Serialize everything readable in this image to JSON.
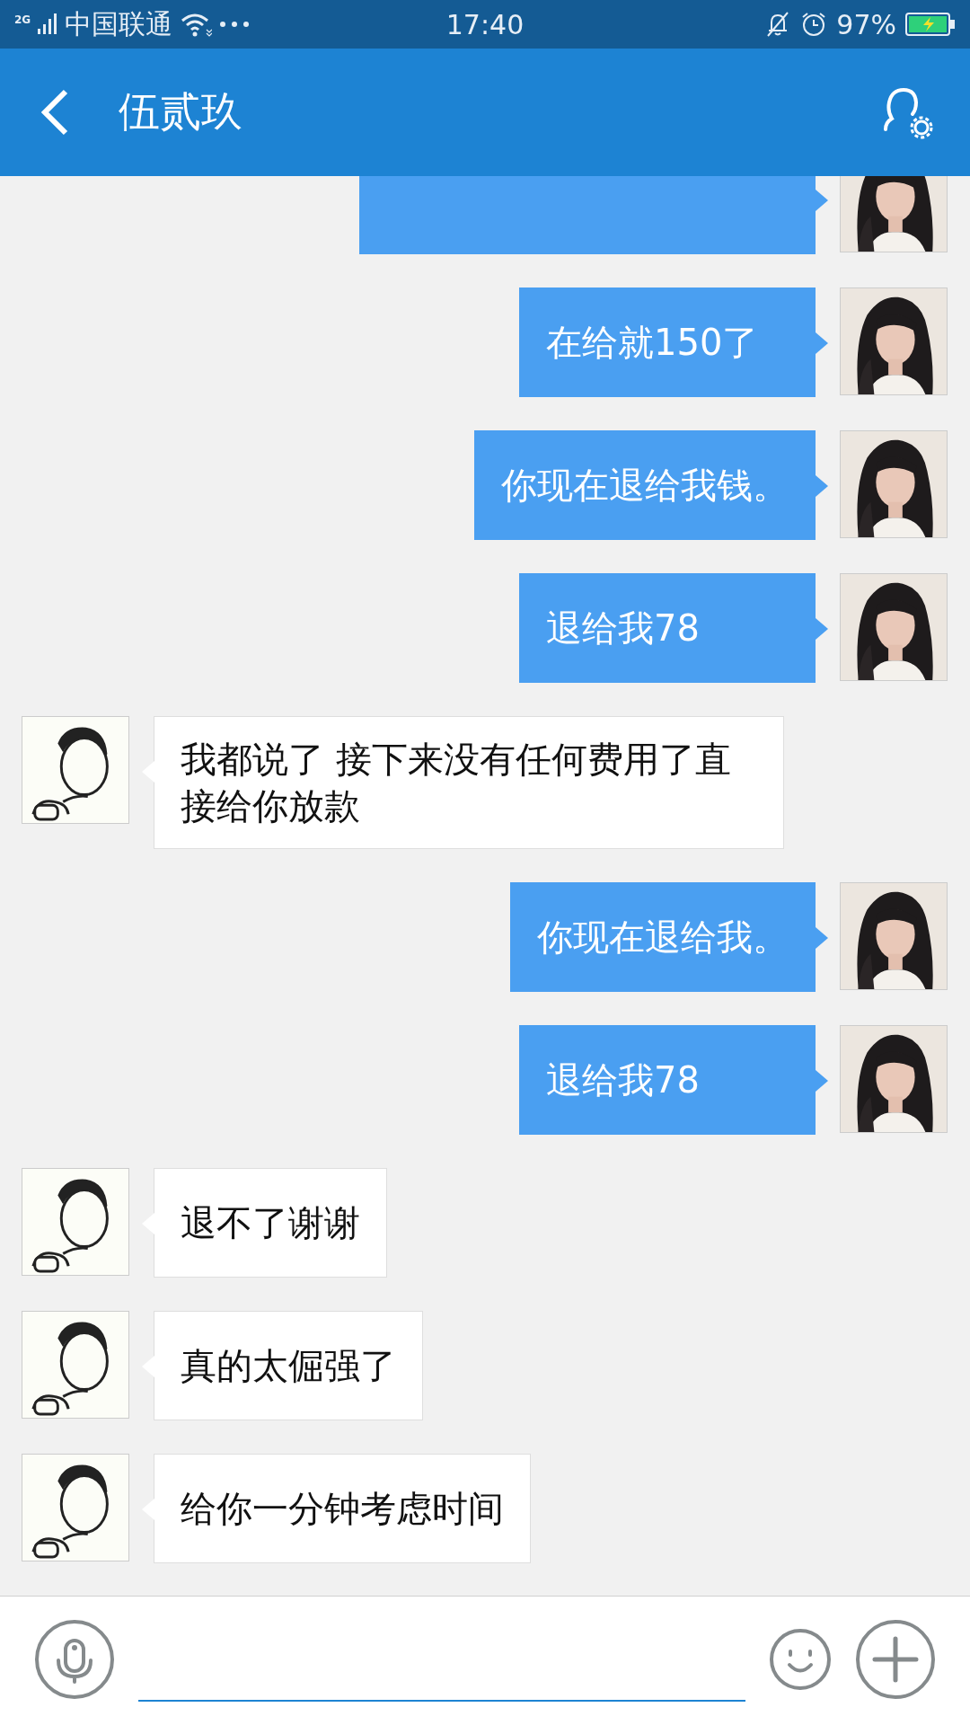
{
  "status_bar": {
    "network": "2G",
    "carrier": "中国联通",
    "time": "17:40",
    "battery": "97%"
  },
  "header": {
    "title": "伍贰玖"
  },
  "messages": [
    {
      "kind": "sent"
    },
    {
      "kind": "sent",
      "text": "在给就150了"
    },
    {
      "kind": "sent",
      "text": "你现在退给我钱。"
    },
    {
      "kind": "sent",
      "text": "退给我78"
    },
    {
      "kind": "received",
      "text": "我都说了 接下来没有任何费用了直接给你放款"
    },
    {
      "kind": "sent",
      "text": "你现在退给我。"
    },
    {
      "kind": "sent",
      "text": "退给我78"
    },
    {
      "kind": "received",
      "text": "退不了谢谢"
    },
    {
      "kind": "received",
      "text": "真的太倔强了"
    },
    {
      "kind": "received",
      "text": "给你一分钟考虑时间"
    }
  ]
}
